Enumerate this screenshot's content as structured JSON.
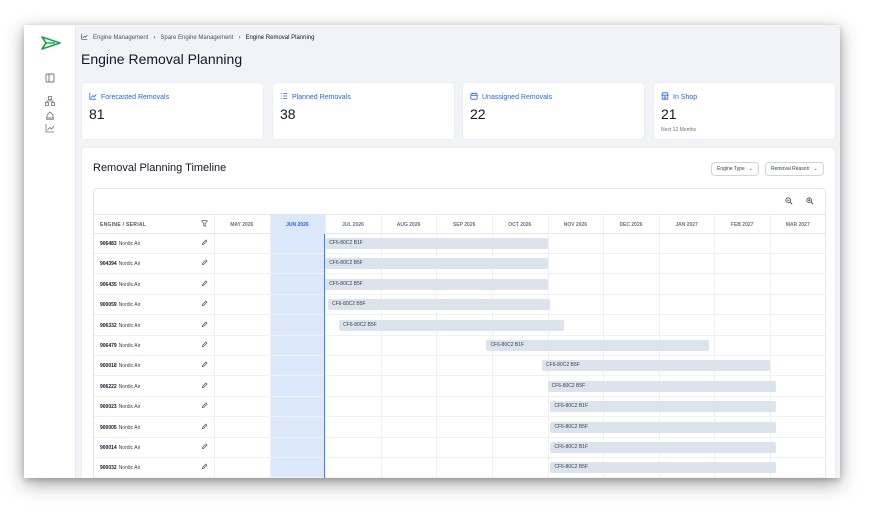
{
  "breadcrumb": {
    "items": [
      "Engine Management",
      "Spare Engine Management"
    ],
    "current": "Engine Removal Planning"
  },
  "page_title": "Engine Removal Planning",
  "cards": [
    {
      "label": "Forecasted Removals",
      "value": "81",
      "icon": "chart-icon",
      "sub": ""
    },
    {
      "label": "Planned Removals",
      "value": "38",
      "icon": "list-icon",
      "sub": ""
    },
    {
      "label": "Unassigned Removals",
      "value": "22",
      "icon": "calendar-icon",
      "sub": ""
    },
    {
      "label": "In Shop",
      "value": "21",
      "icon": "shop-icon",
      "sub": "Next 12 Months"
    }
  ],
  "timeline": {
    "title": "Removal Planning Timeline",
    "filters": [
      "Engine Type",
      "Removal Reason"
    ],
    "engine_col": "ENGINE / SERIAL",
    "months": [
      "MAY 2026",
      "JUN 2026",
      "JUL 2026",
      "AUG 2026",
      "SEP 2026",
      "OCT 2026",
      "NOV 2026",
      "DEC 2026",
      "JAN 2027",
      "FEB 2027",
      "MAR 2027"
    ],
    "current_month_index": 1,
    "rows": [
      {
        "serial": "906483",
        "operator": "Nordic Air",
        "type": "CF6-80C2 B1F",
        "start": 2.0,
        "end": 6.0
      },
      {
        "serial": "904394",
        "operator": "Nordic Air",
        "type": "CF6-80C2 B5F",
        "start": 2.0,
        "end": 6.0
      },
      {
        "serial": "906435",
        "operator": "Nordic Air",
        "type": "CF6-80C2 B5F",
        "start": 2.0,
        "end": 6.0
      },
      {
        "serial": "900059",
        "operator": "Nordic Air",
        "type": "CF6-80C2 B5F",
        "start": 2.05,
        "end": 6.05
      },
      {
        "serial": "906332",
        "operator": "Nordic Air",
        "type": "CF6-80C2 B5F",
        "start": 2.25,
        "end": 6.3
      },
      {
        "serial": "906479",
        "operator": "Nordic Air",
        "type": "CF6-80C2 B1F",
        "start": 4.9,
        "end": 8.9
      },
      {
        "serial": "900018",
        "operator": "Nordic Air",
        "type": "CF6-80C2 B5F",
        "start": 5.9,
        "end": 10.0
      },
      {
        "serial": "906222",
        "operator": "Nordic Air",
        "type": "CF6-80C2 B5F",
        "start": 6.0,
        "end": 10.1
      },
      {
        "serial": "900023",
        "operator": "Nordic Air",
        "type": "CF6-80C2 B1F",
        "start": 6.05,
        "end": 10.1
      },
      {
        "serial": "900005",
        "operator": "Nordic Air",
        "type": "CF6-80C2 B5F",
        "start": 6.05,
        "end": 10.1
      },
      {
        "serial": "900014",
        "operator": "Nordic Air",
        "type": "CF6-80C2 B1F",
        "start": 6.05,
        "end": 10.1
      },
      {
        "serial": "900032",
        "operator": "Nordic Air",
        "type": "CF6-80C2 B5F",
        "start": 6.05,
        "end": 10.1
      }
    ]
  },
  "colors": {
    "accent": "#2563eb",
    "bar": "#dde3ec",
    "current_month": "#dbe7fb",
    "logo": "#16a34a"
  }
}
